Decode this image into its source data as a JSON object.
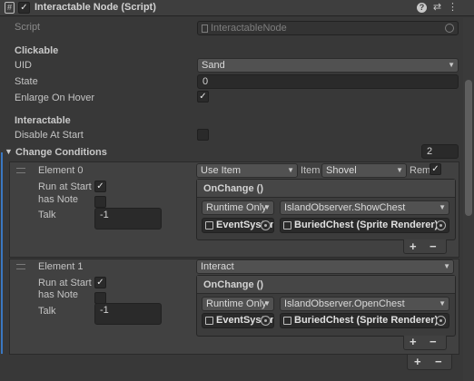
{
  "header": {
    "title": "Interactable Node (Script)",
    "enabled": true,
    "icons": [
      "help-icon",
      "preset-icon",
      "more-icon"
    ]
  },
  "script_row": {
    "label": "Script",
    "value": "InteractableNode"
  },
  "clickable": {
    "section": "Clickable",
    "uid": {
      "label": "UID",
      "value": "Sand"
    },
    "state": {
      "label": "State",
      "value": "0"
    },
    "enlarge": {
      "label": "Enlarge On Hover",
      "checked": true
    }
  },
  "interactable": {
    "section": "Interactable",
    "disable": {
      "label": "Disable At Start",
      "checked": false
    }
  },
  "change_conditions": {
    "label": "Change Conditions",
    "size": "2",
    "elements": [
      {
        "label": "Element 0",
        "action": "Use Item",
        "item_label": "Item",
        "item_value": "Shovel",
        "rem_label": "Rem",
        "rem_checked": true,
        "run_at_start": {
          "label": "Run at Start",
          "checked": true
        },
        "has_note": {
          "label": "has Note",
          "checked": false
        },
        "talk": {
          "label": "Talk",
          "value": "-1"
        },
        "event": {
          "title": "OnChange ()",
          "runtime": "Runtime Only",
          "method": "IslandObserver.ShowChest",
          "obj1": "EventSystem",
          "obj2": "BuriedChest (Sprite Renderer)"
        }
      },
      {
        "label": "Element 1",
        "action": "Interact",
        "run_at_start": {
          "label": "Run at Start",
          "checked": true
        },
        "has_note": {
          "label": "has Note",
          "checked": false
        },
        "talk": {
          "label": "Talk",
          "value": "-1"
        },
        "event": {
          "title": "OnChange ()",
          "runtime": "Runtime Only",
          "method": "IslandObserver.OpenChest",
          "obj1": "EventSystem",
          "obj2": "BuriedChest (Sprite Renderer)"
        }
      }
    ]
  },
  "controls": {
    "plus": "+",
    "minus": "−"
  }
}
